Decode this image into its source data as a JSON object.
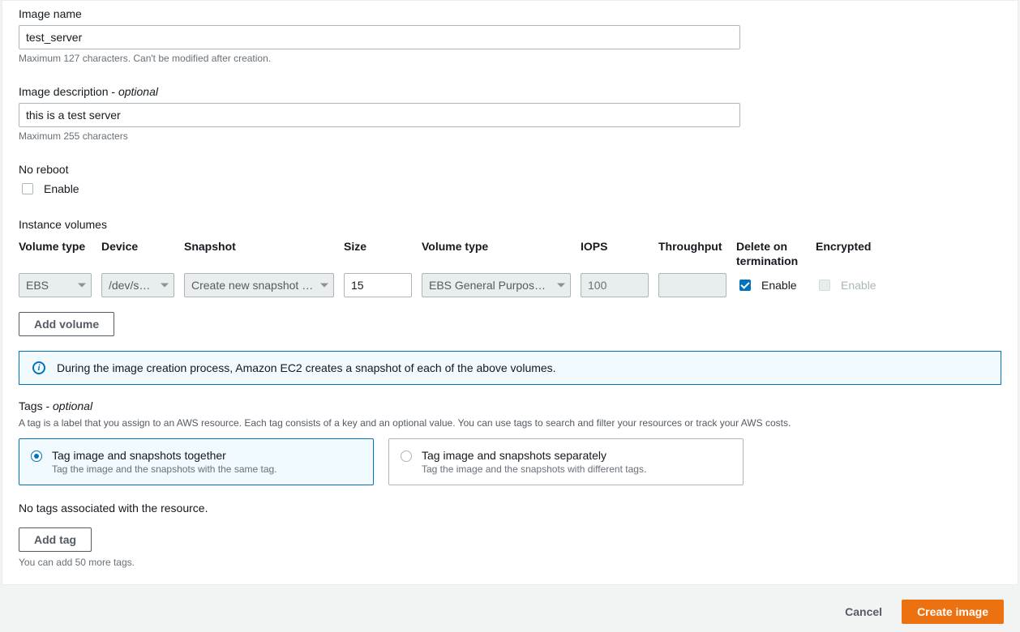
{
  "imageName": {
    "label": "Image name",
    "value": "test_server",
    "hint": "Maximum 127 characters. Can't be modified after creation."
  },
  "imageDescription": {
    "label": "Image description - ",
    "optional": "optional",
    "value": "this is a test server",
    "hint": "Maximum 255 characters"
  },
  "noReboot": {
    "label": "No reboot",
    "enableLabel": "Enable"
  },
  "instanceVolumes": {
    "label": "Instance volumes",
    "headers": {
      "volType1": "Volume type",
      "device": "Device",
      "snapshot": "Snapshot",
      "size": "Size",
      "volType2": "Volume type",
      "iops": "IOPS",
      "throughput": "Throughput",
      "deleteOnTerm": "Delete on termination",
      "encrypted": "Encrypted"
    },
    "row": {
      "volType1": "EBS",
      "device": "/dev/s…",
      "snapshot": "Create new snapshot fr…",
      "size": "15",
      "volType2": "EBS General Purpose SS…",
      "iops": "100",
      "throughput": "",
      "deleteEnable": "Enable",
      "encryptedEnable": "Enable"
    },
    "addVolume": "Add volume",
    "infoText": "During the image creation process, Amazon EC2 creates a snapshot of each of the above volumes."
  },
  "tags": {
    "label": "Tags - ",
    "optional": "optional",
    "desc": "A tag is a label that you assign to an AWS resource. Each tag consists of a key and an optional value. You can use tags to search and filter your resources or track your AWS costs.",
    "together": {
      "title": "Tag image and snapshots together",
      "sub": "Tag the image and the snapshots with the same tag."
    },
    "separately": {
      "title": "Tag image and snapshots separately",
      "sub": "Tag the image and the snapshots with different tags."
    },
    "noTags": "No tags associated with the resource.",
    "addTag": "Add tag",
    "tagHint": "You can add 50 more tags."
  },
  "footer": {
    "cancel": "Cancel",
    "create": "Create image"
  }
}
